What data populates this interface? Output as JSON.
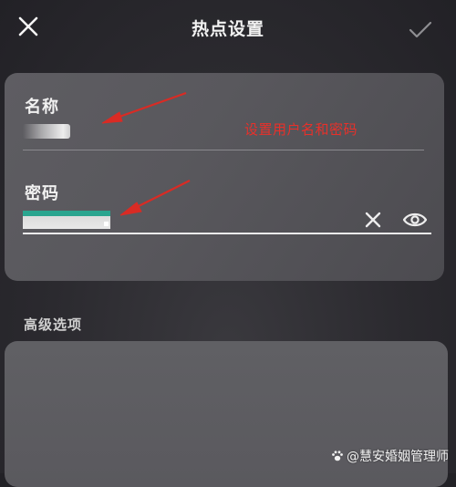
{
  "header": {
    "title": "热点设置",
    "close_icon": "close-icon",
    "confirm_icon": "checkmark-icon"
  },
  "form": {
    "name_label": "名称",
    "password_label": "密码",
    "clear_icon": "clear-icon",
    "visibility_icon": "eye-icon"
  },
  "annotation": {
    "text": "设置用户名和密码",
    "color": "#e8302a"
  },
  "advanced": {
    "title": "高级选项"
  },
  "watermark": {
    "text": "@慧安婚姻管理师"
  },
  "colors": {
    "accent_teal": "#2aa58f",
    "annotation_red": "#e8302a"
  }
}
